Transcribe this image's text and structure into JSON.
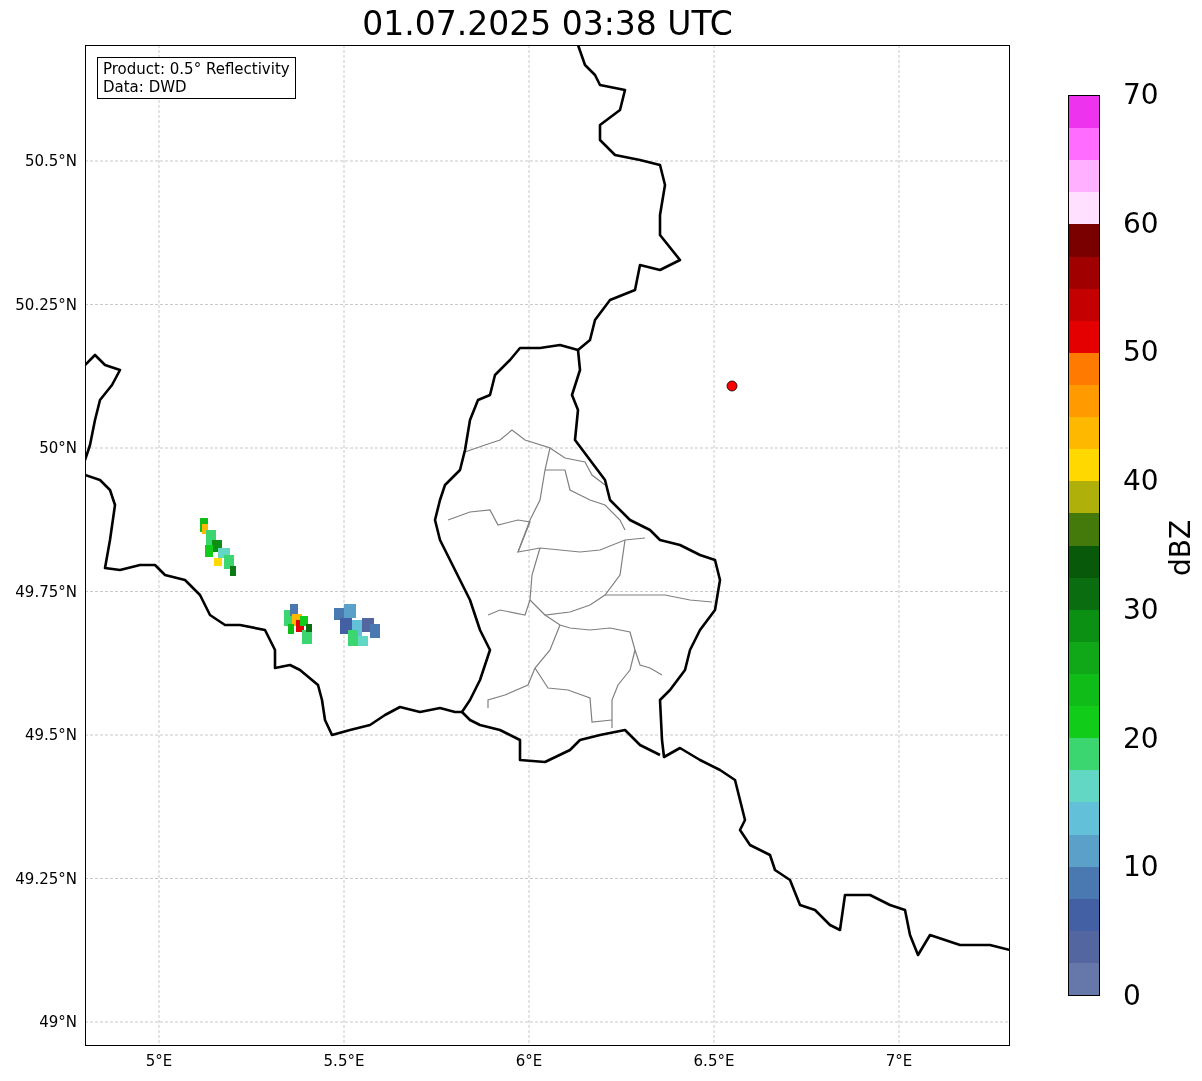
{
  "title": "01.07.2025 03:38 UTC",
  "info_box": {
    "lines": [
      "Product: 0.5° Reflectivity",
      "Data: DWD"
    ]
  },
  "map": {
    "lat_ticks": [
      "50.5°N",
      "50.25°N",
      "50°N",
      "49.75°N",
      "49.5°N",
      "49.25°N",
      "49°N"
    ],
    "lon_ticks": [
      "5°E",
      "5.5°E",
      "6°E",
      "6.5°E",
      "7°E"
    ]
  },
  "colorbar": {
    "label": "dBZ",
    "ticks": [
      "70",
      "60",
      "50",
      "40",
      "30",
      "20",
      "10",
      "0"
    ],
    "bins": [
      {
        "color": "#ee33ee"
      },
      {
        "color": "#ff6cff"
      },
      {
        "color": "#ffb0ff"
      },
      {
        "color": "#ffe0ff"
      },
      {
        "color": "#7a0000"
      },
      {
        "color": "#a00000"
      },
      {
        "color": "#c40000"
      },
      {
        "color": "#e40000"
      },
      {
        "color": "#ff7a00"
      },
      {
        "color": "#ff9a00"
      },
      {
        "color": "#ffb800"
      },
      {
        "color": "#ffd800"
      },
      {
        "color": "#b0b00a"
      },
      {
        "color": "#447a0c"
      },
      {
        "color": "#085a0a"
      },
      {
        "color": "#0a6e10"
      },
      {
        "color": "#0c9014"
      },
      {
        "color": "#10a818"
      },
      {
        "color": "#10bc18"
      },
      {
        "color": "#12cc1a"
      },
      {
        "color": "#3cd670"
      },
      {
        "color": "#62d8c4"
      },
      {
        "color": "#62c0d8"
      },
      {
        "color": "#5aa0c8"
      },
      {
        "color": "#4a78b0"
      },
      {
        "color": "#4460a4"
      },
      {
        "color": "#5466a0"
      },
      {
        "color": "#6677aa"
      }
    ]
  }
}
